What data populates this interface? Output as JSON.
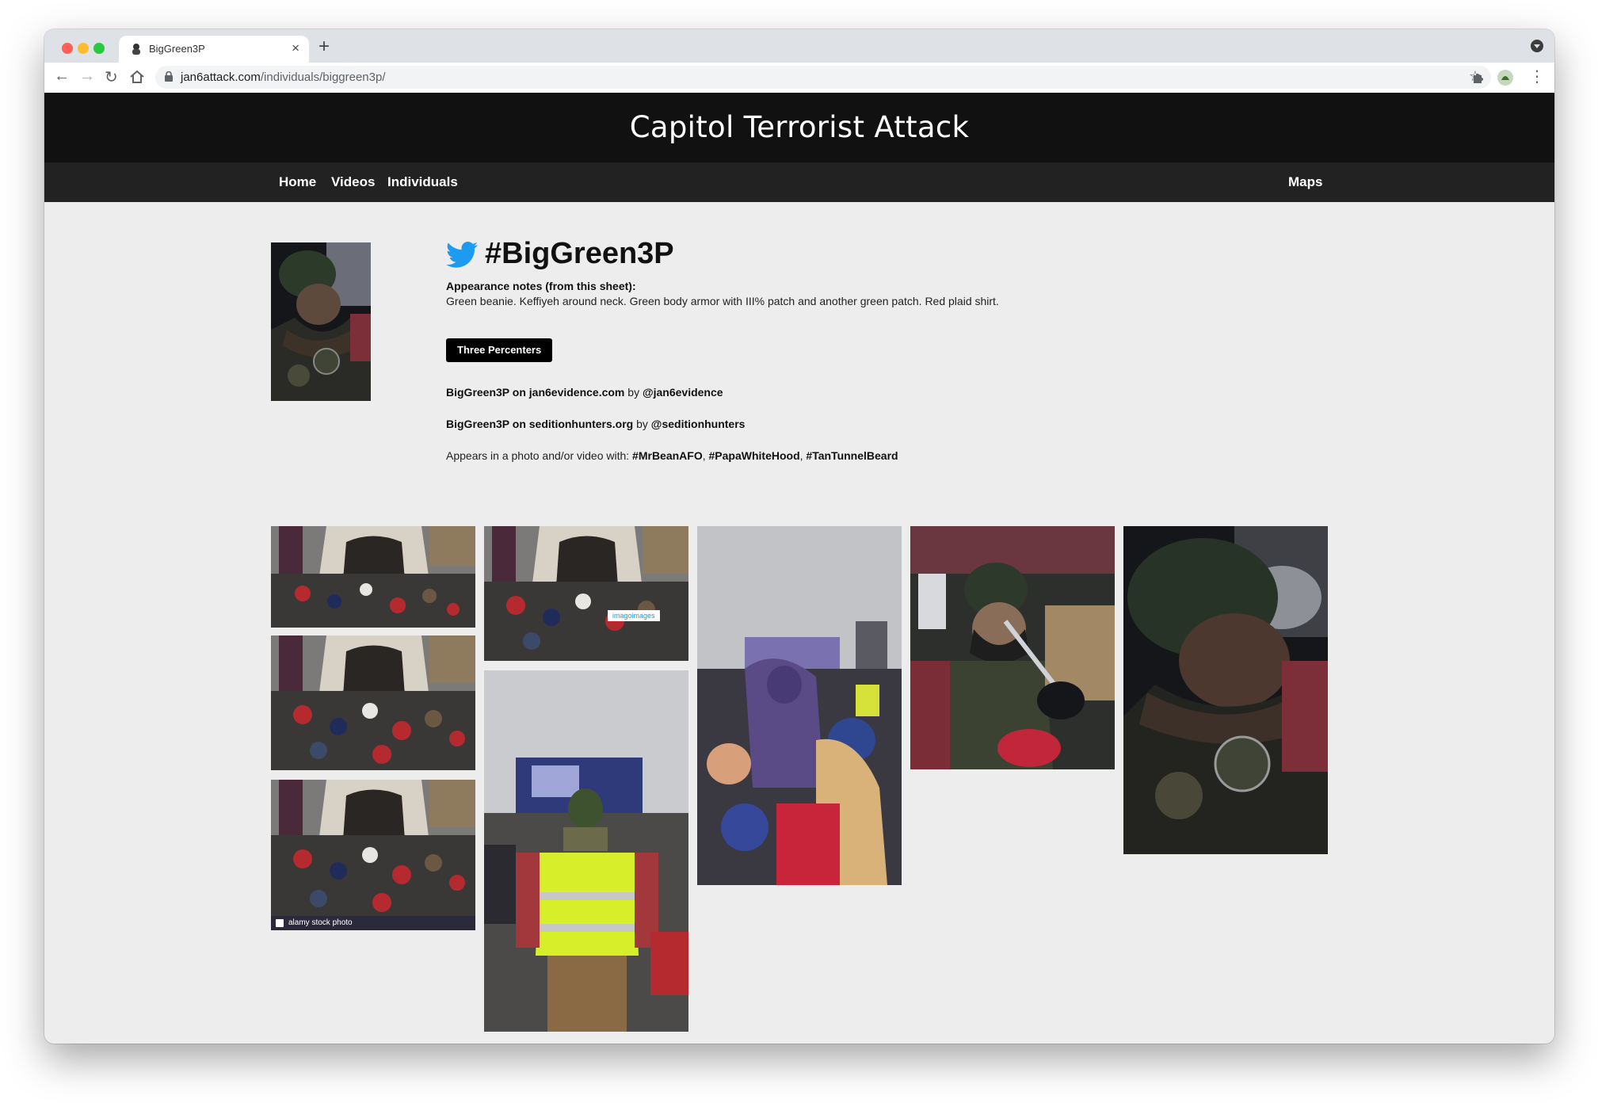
{
  "browser": {
    "tab_title": "BigGreen3P",
    "new_tab_label": "+",
    "close_label": "×",
    "url_domain": "jan6attack.com",
    "url_path": "/individuals/biggreen3p/"
  },
  "site": {
    "title": "Capitol Terrorist Attack",
    "nav": {
      "home": "Home",
      "videos": "Videos",
      "individuals": "Individuals",
      "maps": "Maps"
    }
  },
  "profile": {
    "handle": "#BigGreen3P",
    "notes_label": "Appearance notes (from this sheet):",
    "notes_text": "Green beanie. Keffiyeh around neck. Green body armor with III% patch and another green patch. Red plaid shirt.",
    "group": "Three Percenters",
    "links": [
      {
        "label": "BigGreen3P on jan6evidence.com",
        "by": "by",
        "handle": "@jan6evidence"
      },
      {
        "label": "BigGreen3P on seditionhunters.org",
        "by": "by",
        "handle": "@seditionhunters"
      }
    ],
    "appears_label": "Appears in a photo and/or video with:",
    "appears_with": [
      "#MrBeanAFO",
      "#PapaWhiteHood",
      "#TanTunnelBeard"
    ],
    "separator": ","
  },
  "gallery": {
    "watermark_alamy": "alamy stock photo",
    "watermark_imago": "imagoimages"
  },
  "colors": {
    "header_bg": "#111111",
    "nav_bg": "#222222",
    "page_bg": "#ededed",
    "twitter_blue": "#1d9bf0"
  }
}
